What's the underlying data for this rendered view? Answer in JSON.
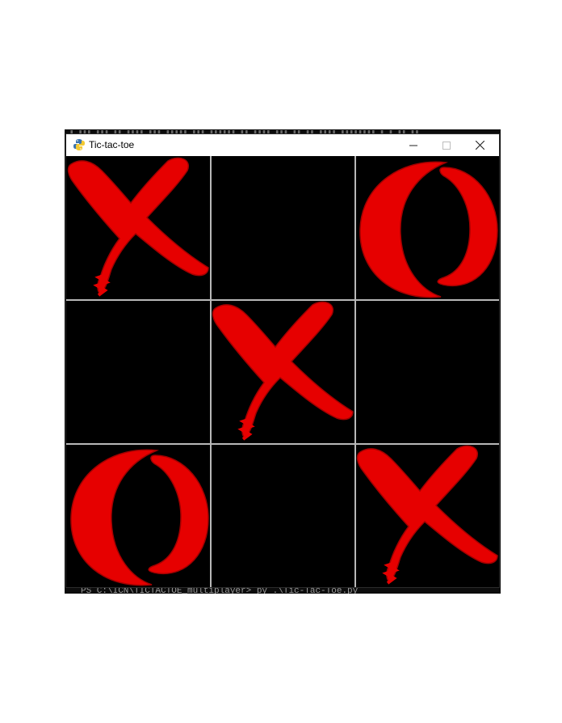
{
  "window": {
    "title": "Tic-tac-toe",
    "app_icon": "python-icon",
    "controls": [
      "minimize-icon",
      "maximize-icon",
      "close-icon"
    ]
  },
  "board": {
    "cells": [
      "X",
      "",
      "O",
      "",
      "X",
      "",
      "O",
      "",
      "X"
    ],
    "mark_color": "#e60000",
    "grid_color": "#b8b8b8",
    "background": "#000000"
  },
  "backdrop": {
    "terminal_line": "PS C:\\ICN\\TICTACTOE_multiplayer> py .\\Tic-Tac-Toe.py"
  }
}
